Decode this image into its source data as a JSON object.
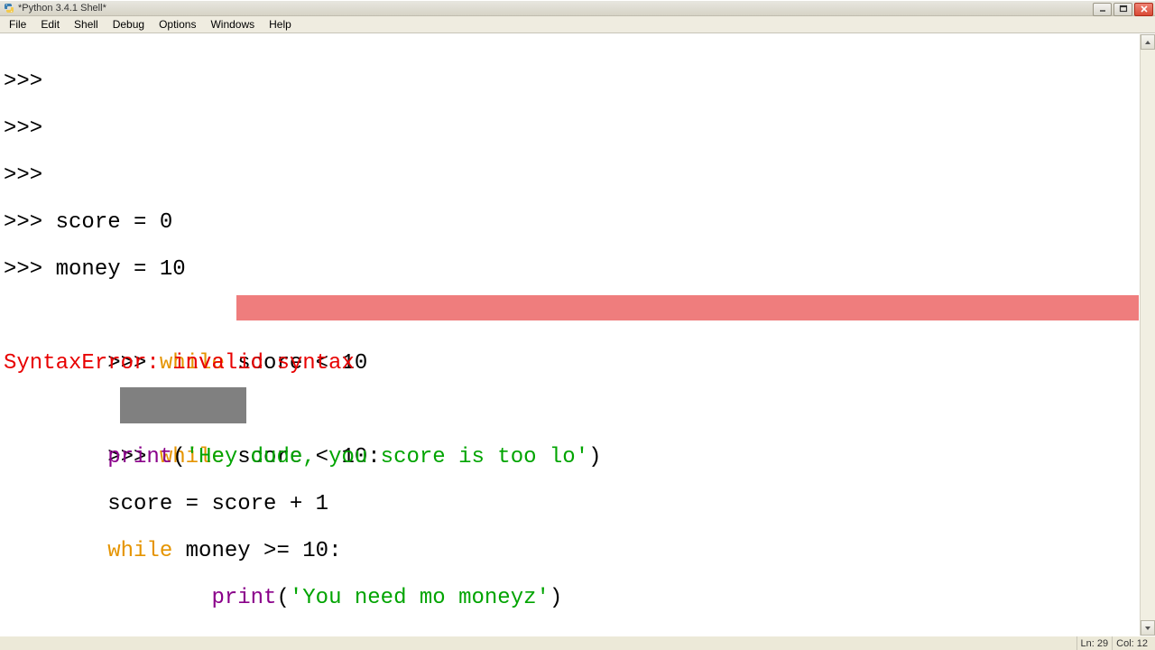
{
  "title": "*Python 3.4.1 Shell*",
  "menu": {
    "file": "File",
    "edit": "Edit",
    "shell": "Shell",
    "debug": "Debug",
    "options": "Options",
    "windows": "Windows",
    "help": "Help"
  },
  "prompt": ">>> ",
  "code": {
    "score_line": "score = 0",
    "money_line": "money = 10",
    "while1_kw": "while",
    "while1_cond": " score < 10",
    "error": "SyntaxError: invalid syntax",
    "while2_kw": "while",
    "while2_cond_pre": " ",
    "while2_cond_sel": "score < 10:",
    "print1_fn": "print",
    "print1_paren_open": "(",
    "print1_str": "'Hey dude, you score is too lo'",
    "print1_paren_close": ")",
    "score_inc": "score = score + 1",
    "while3_kw": "while",
    "while3_rest": " money >= 10:",
    "print2_fn": "print",
    "print2_paren_open": "(",
    "print2_str": "'You need mo moneyz'",
    "print2_paren_close": ")"
  },
  "status": {
    "line": "Ln: 29",
    "col": "Col: 12"
  }
}
